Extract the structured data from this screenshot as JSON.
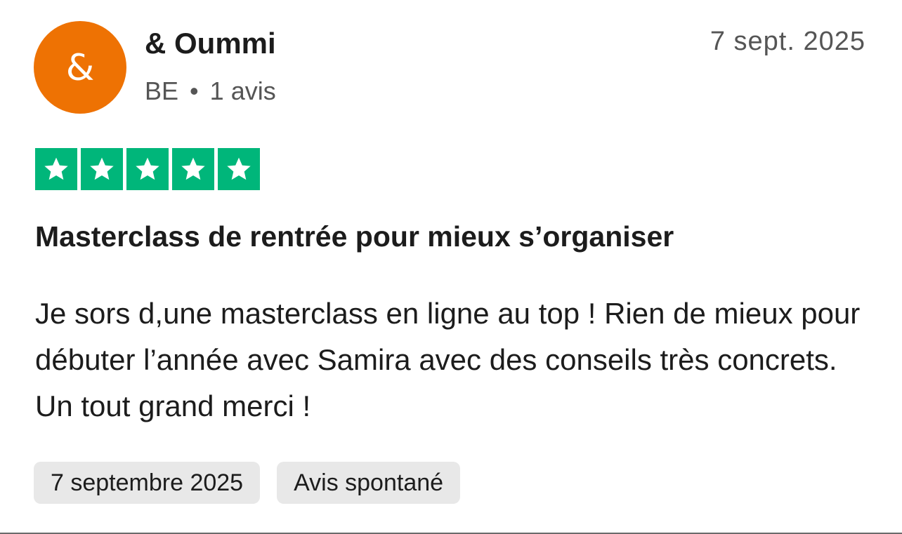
{
  "reviewer": {
    "avatar_initial": "&",
    "avatar_color": "#ee7203",
    "name": "& Oummi",
    "country": "BE",
    "separator": "•",
    "review_count": "1 avis"
  },
  "review": {
    "date_short": "7 sept. 2025",
    "rating": 5,
    "rating_max": 5,
    "star_color": "#00b67a",
    "title": "Masterclass de rentrée pour mieux s’organiser",
    "body": "Je sors d,une masterclass en ligne au top ! Rien de mieux pour débuter l’année avec Samira avec des conseils très concrets. Un tout grand merci !",
    "chips": {
      "experience_date": "7 septembre 2025",
      "review_type": "Avis spontané"
    }
  }
}
